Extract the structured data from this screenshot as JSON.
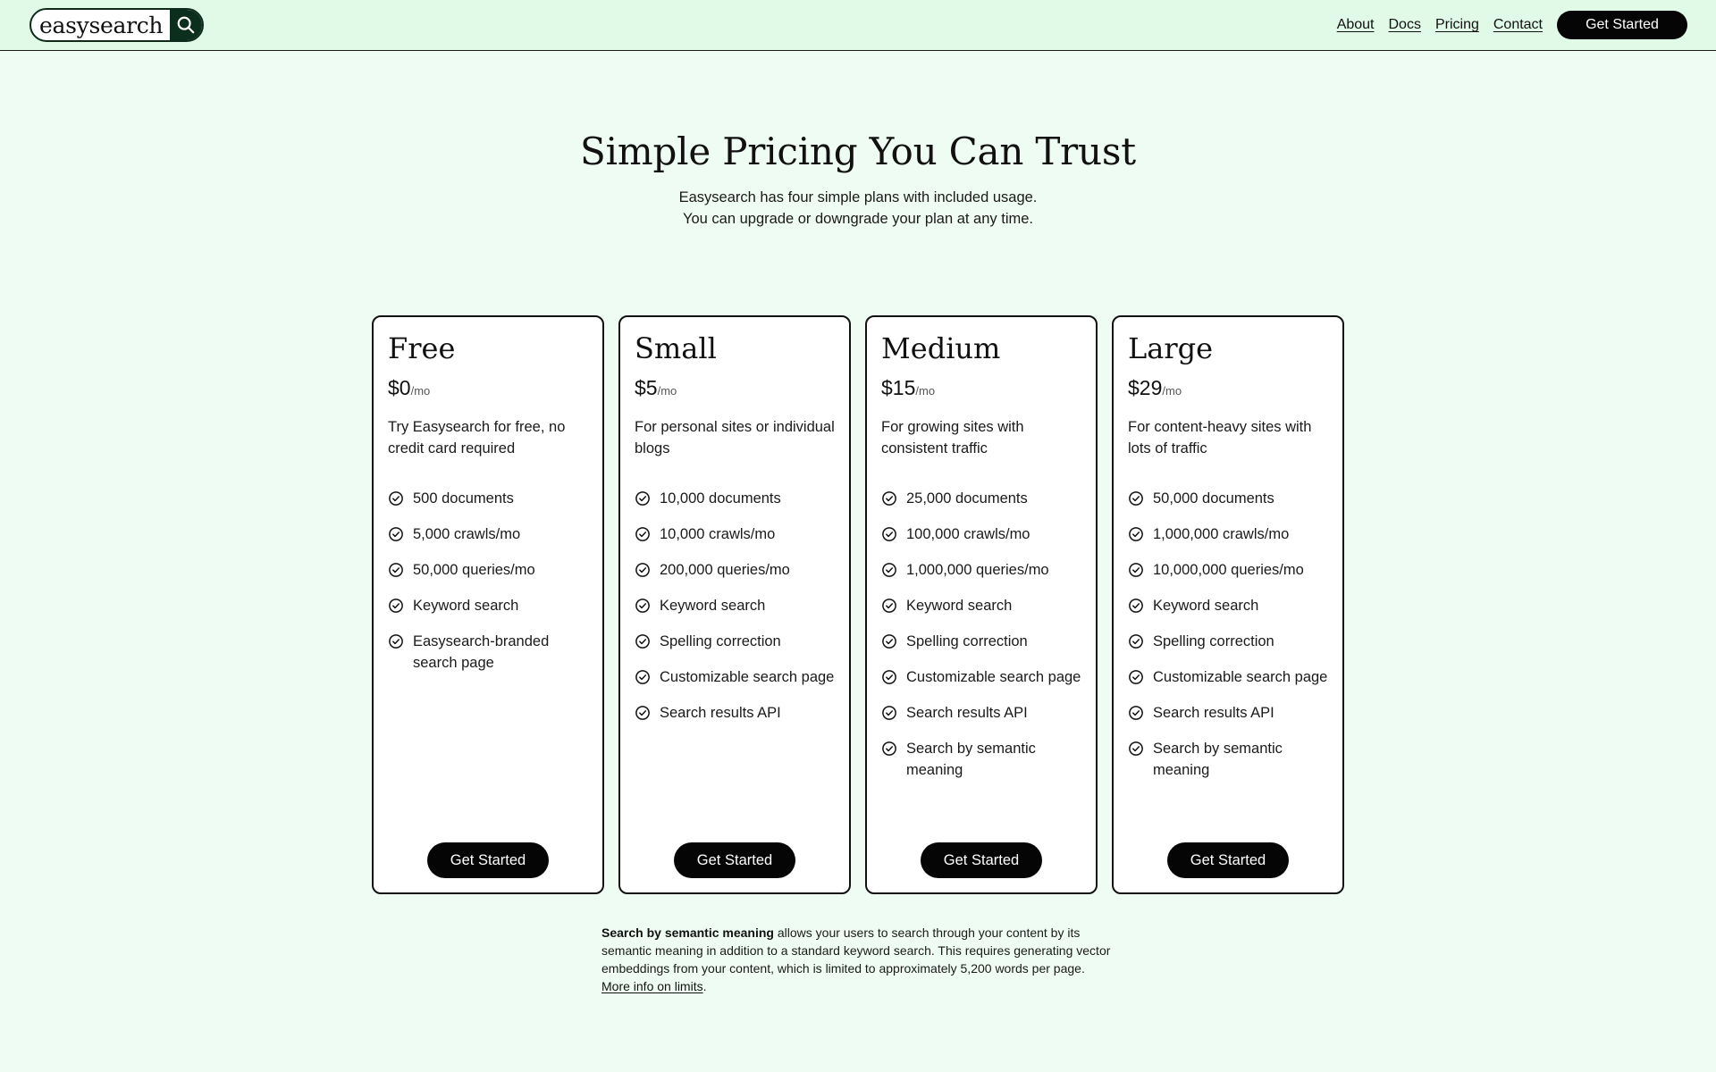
{
  "header": {
    "logo_text": "easysearch",
    "nav": [
      "About",
      "Docs",
      "Pricing",
      "Contact"
    ],
    "cta_label": "Get Started"
  },
  "hero": {
    "title": "Simple Pricing You Can Trust",
    "subtitle_line1": "Easysearch has four simple plans with included usage.",
    "subtitle_line2": "You can upgrade or downgrade your plan at any time."
  },
  "plans": [
    {
      "name": "Free",
      "price": "$0",
      "period": "/mo",
      "description": "Try Easysearch for free, no credit card required",
      "features": [
        "500 documents",
        "5,000 crawls/mo",
        "50,000 queries/mo",
        "Keyword search",
        "Easysearch-branded search page"
      ],
      "cta": "Get Started"
    },
    {
      "name": "Small",
      "price": "$5",
      "period": "/mo",
      "description": "For personal sites or individual blogs",
      "features": [
        "10,000 documents",
        "10,000 crawls/mo",
        "200,000 queries/mo",
        "Keyword search",
        "Spelling correction",
        "Customizable search page",
        "Search results API"
      ],
      "cta": "Get Started"
    },
    {
      "name": "Medium",
      "price": "$15",
      "period": "/mo",
      "description": "For growing sites with consistent traffic",
      "features": [
        "25,000 documents",
        "100,000 crawls/mo",
        "1,000,000 queries/mo",
        "Keyword search",
        "Spelling correction",
        "Customizable search page",
        "Search results API",
        "Search by semantic meaning"
      ],
      "cta": "Get Started"
    },
    {
      "name": "Large",
      "price": "$29",
      "period": "/mo",
      "description": "For content-heavy sites with lots of traffic",
      "features": [
        "50,000 documents",
        "1,000,000 crawls/mo",
        "10,000,000 queries/mo",
        "Keyword search",
        "Spelling correction",
        "Customizable search page",
        "Search results API",
        "Search by semantic meaning"
      ],
      "cta": "Get Started"
    }
  ],
  "footnote": {
    "bold": "Search by semantic meaning",
    "text": " allows your users to search through your content by its semantic meaning in addition to a standard keyword search. This requires generating vector embeddings from your content, which is limited to approximately 5,200 words per page. ",
    "link": "More info on limits",
    "end": "."
  },
  "icons": {
    "logo_mark": "search-icon",
    "feature_bullet": "check-circle-icon"
  },
  "colors": {
    "page_bg": "#effcf3",
    "header_bg": "#e1f9e7",
    "button_bg": "#050505",
    "logo_mark_bg": "#0c2e1c"
  }
}
